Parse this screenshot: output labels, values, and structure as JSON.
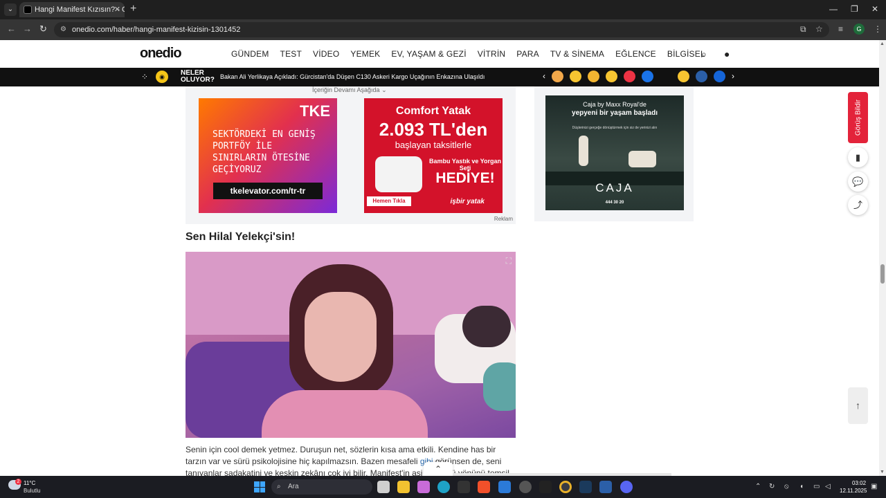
{
  "browser": {
    "tab_title": "Hangi Manifest Kızısın? - Oned",
    "tab_close": "✕",
    "new_tab": "+",
    "url": "onedio.com/haber/hangi-manifest-kizisin-1301452",
    "window_controls": [
      "—",
      "❐",
      "✕"
    ]
  },
  "site": {
    "logo": "onedio",
    "nav": [
      "GÜNDEM",
      "TEST",
      "VİDEO",
      "YEMEK",
      "EV, YAŞAM & GEZİ",
      "VİTRİN",
      "PARA",
      "TV & SİNEMA",
      "EĞLENCE",
      "BİLGİSEL"
    ],
    "ticker_label_1": "NELER",
    "ticker_label_2": "OLUYOR?",
    "ticker_text": "Bakan Ali Yerlikaya Açıkladı: Gürcistan'da Düşen C130 Askeri Kargo Uçağının Enkazına Ulaşıldı",
    "emoji_colors": [
      "#f2a84a",
      "#f7c531",
      "#f2b531",
      "#f7c531",
      "#e34",
      "#1a73e8",
      "#111",
      "#f7c531",
      "#2b5fa8",
      "#1565d8"
    ]
  },
  "ads": {
    "continue_text": "İçeriğin Devamı Aşağıda",
    "reklam": "Reklam",
    "tke_logo": "TKE",
    "tke_copy": "SEKTÖRDEKİ EN GENİŞ PORTFÖY İLE SINIRLARIN ÖTESİNE GEÇİYORUZ",
    "tke_url": "tkelevator.com/tr-tr",
    "yatak_title": "Comfort Yatak",
    "yatak_price": "2.093 TL'den",
    "yatak_sub": "başlayan taksitlerle",
    "yatak_gift_label": "Bambu Yastık ve Yorgan Seti",
    "yatak_gift": "HEDİYE!",
    "yatak_btn": "Hemen Tıkla",
    "yatak_brand": "işbir yatak",
    "caja_line1": "Caja by Maxx Royal'de",
    "caja_line2": "yepyeni bir yaşam başladı",
    "caja_line3": "Düşlerinizi gerçeğe dönüştürmek için siz de yerinizi alın",
    "caja_name": "CAJA",
    "caja_phone": "444 30 20"
  },
  "article": {
    "title": "Sen Hilal Yelekçi'sin!",
    "body_1": "Senin için cool demek yetmez. Duruşun net, sözlerin kısa ama etkili. Kendine has bir tarzın var ve sürü psikolojisine hiç kapılmazsın. Bazen mesafeli ",
    "body_link": "gibi",
    "body_2": " görünsen de, seni tanıyanlar sadakatini ve keskin zekânı çok iyi bilir. Manifest'in asi ve güçlü yönünü temsil ediyorsun."
  },
  "floating": {
    "feedback": "Görüş Bildir"
  },
  "taskbar": {
    "temp": "11°C",
    "weather": "Bulutlu",
    "weather_badge": "2",
    "search": "Ara",
    "time": "03:02",
    "date": "12.11.2025"
  }
}
